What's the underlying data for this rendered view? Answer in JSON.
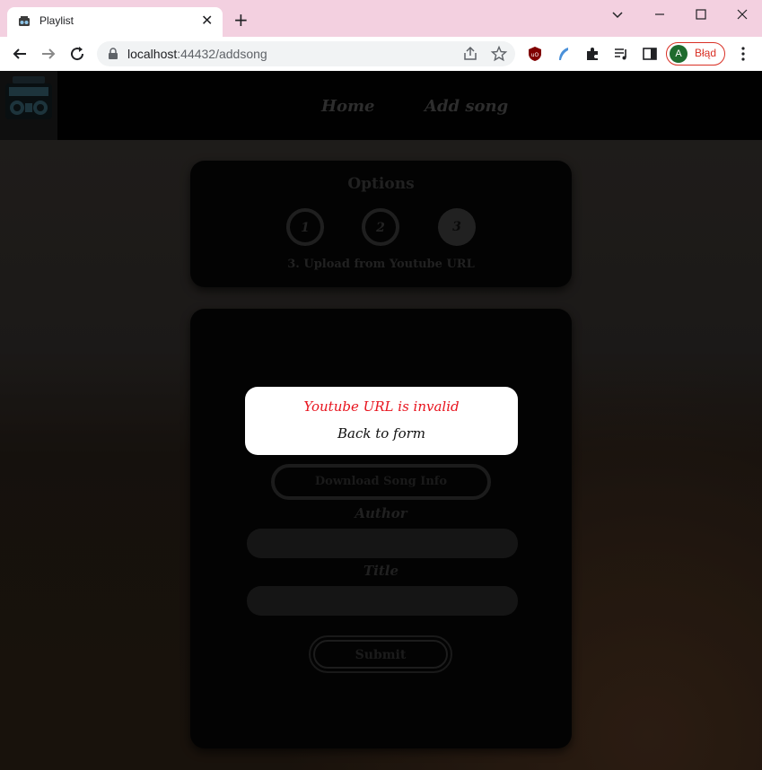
{
  "browser": {
    "tab_title": "Playlist",
    "tab_close": "✕",
    "new_tab": "+",
    "url_host": "localhost",
    "url_rest": ":44432/addsong",
    "profile_initial": "A",
    "profile_label": "Błąd"
  },
  "nav": {
    "links": [
      {
        "label": "Home"
      },
      {
        "label": "Add song"
      }
    ]
  },
  "options": {
    "title": "Options",
    "steps": [
      {
        "label": "1",
        "active": false
      },
      {
        "label": "2",
        "active": false
      },
      {
        "label": "3",
        "active": true
      }
    ],
    "caption": "3. Upload from Youtube URL"
  },
  "form": {
    "download_label": "Download Song Info",
    "author_label": "Author",
    "author_value": "",
    "title_label": "Title",
    "title_value": "",
    "submit_label": "Submit"
  },
  "modal": {
    "message": "Youtube URL is invalid",
    "action": "Back to form"
  },
  "colors": {
    "tabbar": "#f3d0e0",
    "error": "#e8141e",
    "profile_accent": "#d93025"
  }
}
